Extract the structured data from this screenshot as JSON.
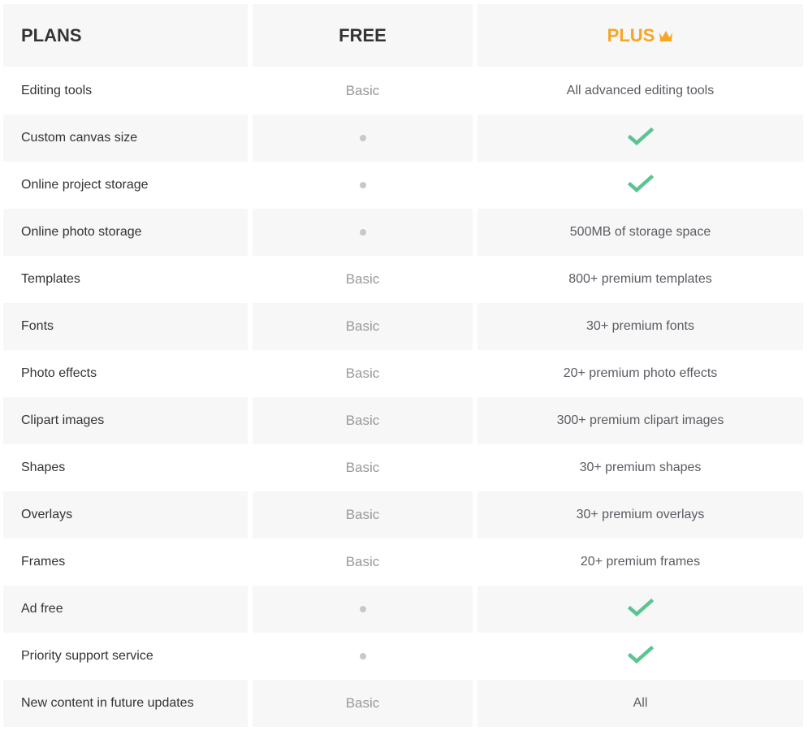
{
  "header": {
    "plans_label": "PLANS",
    "free_label": "FREE",
    "plus_label": "PLUS",
    "plus_icon": "crown-icon",
    "plus_color": "#f5a623"
  },
  "colors": {
    "check": "#5cc492",
    "dot": "#c8c8c8"
  },
  "rows": [
    {
      "feature": "Editing tools",
      "free": "Basic",
      "plus": "All advanced editing tools"
    },
    {
      "feature": "Custom canvas size",
      "free": "dot-icon",
      "plus": "check-icon"
    },
    {
      "feature": "Online project storage",
      "free": "dot-icon",
      "plus": "check-icon"
    },
    {
      "feature": "Online photo storage",
      "free": "dot-icon",
      "plus": "500MB of storage space"
    },
    {
      "feature": "Templates",
      "free": "Basic",
      "plus": "800+ premium templates"
    },
    {
      "feature": "Fonts",
      "free": "Basic",
      "plus": "30+ premium fonts"
    },
    {
      "feature": "Photo effects",
      "free": "Basic",
      "plus": "20+ premium photo effects"
    },
    {
      "feature": "Clipart images",
      "free": "Basic",
      "plus": "300+ premium clipart images"
    },
    {
      "feature": "Shapes",
      "free": "Basic",
      "plus": "30+ premium shapes"
    },
    {
      "feature": "Overlays",
      "free": "Basic",
      "plus": "30+ premium overlays"
    },
    {
      "feature": "Frames",
      "free": "Basic",
      "plus": "20+ premium frames"
    },
    {
      "feature": "Ad free",
      "free": "dot-icon",
      "plus": "check-icon"
    },
    {
      "feature": "Priority support service",
      "free": "dot-icon",
      "plus": "check-icon"
    },
    {
      "feature": "New content in future updates",
      "free": "Basic",
      "plus": "All"
    }
  ]
}
